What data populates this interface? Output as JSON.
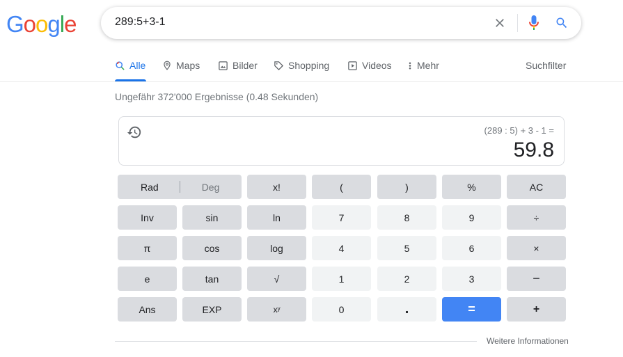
{
  "logo": {
    "letters": [
      "G",
      "o",
      "o",
      "g",
      "l",
      "e"
    ],
    "colors": [
      "#4285f4",
      "#ea4335",
      "#fbbc05",
      "#4285f4",
      "#34a853",
      "#ea4335"
    ]
  },
  "search": {
    "query": "289:5+3-1",
    "clear_icon": "close-icon",
    "mic_icon": "mic-icon",
    "search_icon": "search-icon"
  },
  "tabs": [
    {
      "label": "Alle",
      "icon": "search-icon",
      "active": true
    },
    {
      "label": "Maps",
      "icon": "map-pin-icon"
    },
    {
      "label": "Bilder",
      "icon": "image-icon"
    },
    {
      "label": "Shopping",
      "icon": "tag-icon"
    },
    {
      "label": "Videos",
      "icon": "play-icon"
    },
    {
      "label": "Mehr",
      "icon": "more-vert-icon"
    }
  ],
  "filter_label": "Suchfilter",
  "stats": "Ungefähr 372'000 Ergebnisse (0.48 Sekunden)",
  "calculator": {
    "expression": "(289 : 5) + 3 - 1 =",
    "result": "59.8",
    "history_icon": "history-icon",
    "keys": {
      "rad": "Rad",
      "deg": "Deg",
      "fact": "x!",
      "lparen": "(",
      "rparen": ")",
      "percent": "%",
      "ac": "AC",
      "inv": "Inv",
      "sin": "sin",
      "ln": "ln",
      "n7": "7",
      "n8": "8",
      "n9": "9",
      "div": "÷",
      "pi": "π",
      "cos": "cos",
      "log": "log",
      "n4": "4",
      "n5": "5",
      "n6": "6",
      "mul": "×",
      "e": "e",
      "tan": "tan",
      "sqrt": "√",
      "n1": "1",
      "n2": "2",
      "n3": "3",
      "minus": "−",
      "ans": "Ans",
      "exp": "EXP",
      "pow": "xʸ",
      "n0": "0",
      "dot": ".",
      "eq": "=",
      "plus": "+"
    }
  },
  "footer_link": "Weitere Informationen",
  "colors": {
    "accent": "#1a73e8",
    "equals_key": "#4285f4",
    "op_key": "#dadce0",
    "num_key": "#f1f3f4"
  }
}
